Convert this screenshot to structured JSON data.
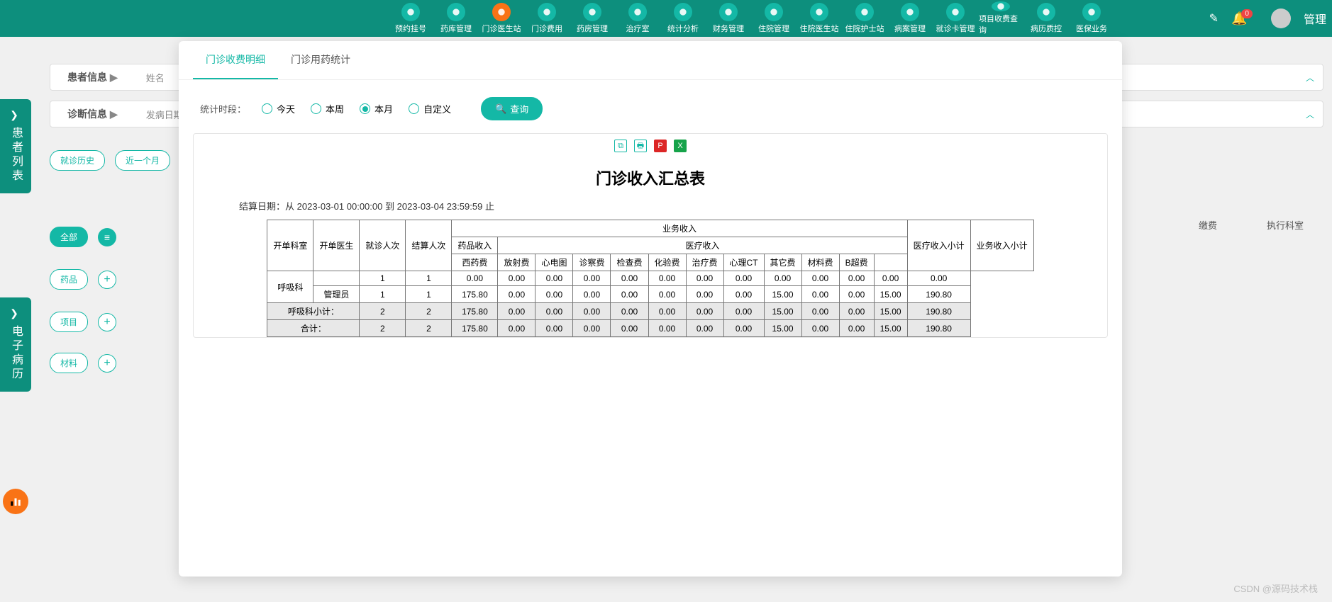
{
  "header": {
    "nav": [
      {
        "label": "预约挂号",
        "active": false
      },
      {
        "label": "药库管理",
        "active": false
      },
      {
        "label": "门诊医生站",
        "active": true
      },
      {
        "label": "门诊费用",
        "active": false
      },
      {
        "label": "药房管理",
        "active": false
      },
      {
        "label": "治疗室",
        "active": false
      },
      {
        "label": "统计分析",
        "active": false
      },
      {
        "label": "财务管理",
        "active": false
      },
      {
        "label": "住院管理",
        "active": false
      },
      {
        "label": "住院医生站",
        "active": false
      },
      {
        "label": "住院护士站",
        "active": false
      },
      {
        "label": "病案管理",
        "active": false
      },
      {
        "label": "就诊卡管理",
        "active": false
      },
      {
        "label": "项目收费查询",
        "active": false
      },
      {
        "label": "病历质控",
        "active": false
      },
      {
        "label": "医保业务",
        "active": false
      }
    ],
    "badge": "0",
    "user_label": "管理"
  },
  "bg": {
    "patient_info": "患者信息",
    "name_label": "姓名",
    "diag_info": "诊断信息",
    "onset_label": "发病日期",
    "left_tab1": "患者列表",
    "left_tab2": "电子病历",
    "history": "就诊历史",
    "recent": "近一个月",
    "all": "全部",
    "cat_drug": "药品",
    "cat_item": "项目",
    "cat_mat": "材料",
    "col_fee": "缴费",
    "col_dept": "执行科室"
  },
  "modal": {
    "tabs": {
      "detail": "门诊收费明细",
      "drug": "门诊用药统计"
    },
    "filter_label": "统计时段：",
    "radios": {
      "today": "今天",
      "week": "本周",
      "month": "本月",
      "custom": "自定义"
    },
    "query": "查询"
  },
  "report": {
    "title": "门诊收入汇总表",
    "date_prefix": "结算日期：从",
    "date_from": "2023-03-01 00:00:00",
    "date_mid": "到",
    "date_to": "2023-03-04 23:59:59",
    "date_suffix": "止",
    "headers": {
      "biz": "业务收入",
      "drug": "药品收入",
      "med": "医疗收入",
      "dept": "开单科室",
      "doctor": "开单医生",
      "visits": "就诊人次",
      "settle": "结算人次",
      "west": "西药费",
      "rad": "放射费",
      "ecg": "心电图",
      "diag": "诊察费",
      "exam": "检查费",
      "lab": "化验费",
      "treat": "治疗费",
      "ct": "心理CT",
      "other": "其它费",
      "mat": "材料费",
      "bscan": "B超费",
      "med_sub": "医疗收入小计",
      "biz_sub": "业务收入小计"
    },
    "rows": [
      {
        "dept": "呼吸科",
        "doctor": "",
        "visits": "1",
        "settle": "1",
        "west": "0.00",
        "rad": "0.00",
        "ecg": "0.00",
        "diag": "0.00",
        "exam": "0.00",
        "lab": "0.00",
        "treat": "0.00",
        "ct": "0.00",
        "other": "0.00",
        "mat": "0.00",
        "bscan": "0.00",
        "med_sub": "0.00",
        "biz_sub": "0.00",
        "sub": false
      },
      {
        "dept": "",
        "doctor": "管理员",
        "visits": "1",
        "settle": "1",
        "west": "175.80",
        "rad": "0.00",
        "ecg": "0.00",
        "diag": "0.00",
        "exam": "0.00",
        "lab": "0.00",
        "treat": "0.00",
        "ct": "0.00",
        "other": "15.00",
        "mat": "0.00",
        "bscan": "0.00",
        "med_sub": "15.00",
        "biz_sub": "190.80",
        "sub": false
      },
      {
        "dept": "呼吸科小计：",
        "span": 2,
        "visits": "2",
        "settle": "2",
        "west": "175.80",
        "rad": "0.00",
        "ecg": "0.00",
        "diag": "0.00",
        "exam": "0.00",
        "lab": "0.00",
        "treat": "0.00",
        "ct": "0.00",
        "other": "15.00",
        "mat": "0.00",
        "bscan": "0.00",
        "med_sub": "15.00",
        "biz_sub": "190.80",
        "sub": true
      },
      {
        "dept": "合计：",
        "span": 2,
        "visits": "2",
        "settle": "2",
        "west": "175.80",
        "rad": "0.00",
        "ecg": "0.00",
        "diag": "0.00",
        "exam": "0.00",
        "lab": "0.00",
        "treat": "0.00",
        "ct": "0.00",
        "other": "15.00",
        "mat": "0.00",
        "bscan": "0.00",
        "med_sub": "15.00",
        "biz_sub": "190.80",
        "sub": true
      }
    ]
  },
  "watermark": "CSDN @源码技术栈"
}
